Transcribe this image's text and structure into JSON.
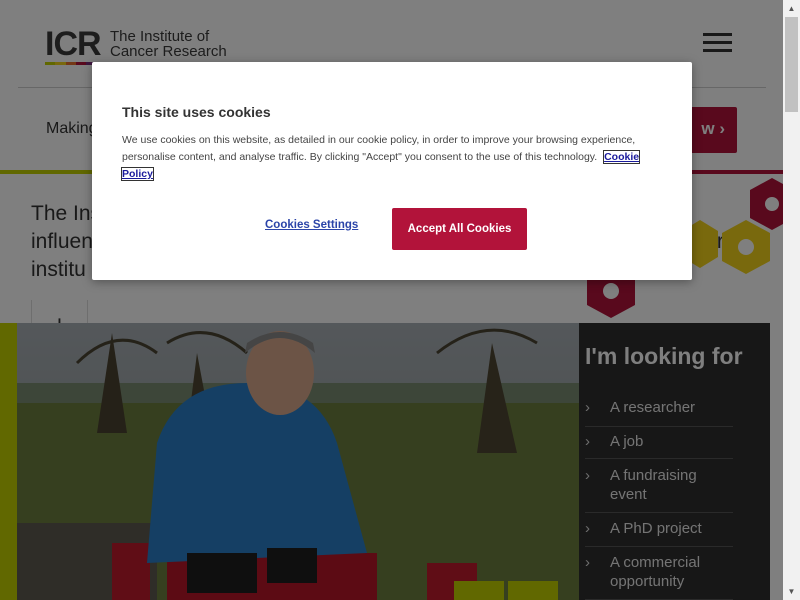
{
  "header": {
    "logo_short": "ICR",
    "logo_line1": "The Institute of",
    "logo_line2": "Cancer Research",
    "menu_icon": "hamburger-menu-icon"
  },
  "banner": {
    "making_text": "Making",
    "view_label": "w ›"
  },
  "intro": {
    "line1": "The Ins",
    "line2": "influen",
    "line3": "institu",
    "right_fragment": "mber"
  },
  "looking_for": {
    "title": "I'm looking for",
    "items": [
      {
        "label": "A researcher"
      },
      {
        "label": "A job"
      },
      {
        "label": "A fundraising event"
      },
      {
        "label": "A PhD project"
      },
      {
        "label": "A commercial opportunity"
      }
    ]
  },
  "cookie_dialog": {
    "title": "This site uses cookies",
    "body": "We use cookies on this website, as detailed in our cookie policy, in order to improve your browsing experience, personalise content, and analyse traffic. By clicking \"Accept\" you consent to the use of this technology.",
    "policy_link": "Cookie Policy",
    "settings_label": "Cookies Settings",
    "accept_label": "Accept All Cookies"
  },
  "colors": {
    "brand_red": "#b2133a",
    "brand_green": "#c3d100",
    "brand_yellow": "#f2d21a",
    "panel_dark": "#2e2e2e"
  }
}
